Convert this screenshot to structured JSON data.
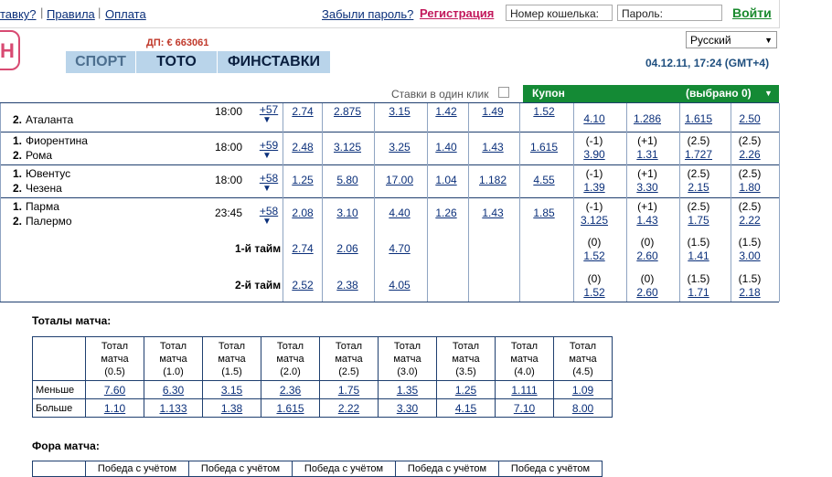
{
  "topbar": {
    "link_bet": "тавку?",
    "link_rules": "Правила",
    "link_payment": "Оплата",
    "forgot": "Забыли пароль?",
    "register": "Регистрация",
    "wallet_placeholder": "Номер кошелька:",
    "password_placeholder": "Пароль:",
    "login": "Войти"
  },
  "header": {
    "dp": "ДП: € 663061",
    "tabs": [
      "СПОРТ",
      "ТОТО",
      "ФИНСТАВКИ"
    ],
    "lang": "Русский",
    "datetime": "04.12.11, 17:24 (GMT+4)"
  },
  "coupon": {
    "one_click": "Ставки в один клик",
    "label": "Купон",
    "selected": "(выбрано 0)"
  },
  "matches": [
    {
      "team1": "",
      "team2": "Аталанта",
      "time": "18:00",
      "plus": "+57",
      "odds": [
        "2.74",
        "2.875",
        "3.15",
        "1.42",
        "1.49",
        "1.52"
      ],
      "fora1_h": "",
      "fora1_v": "4.10",
      "fora2_h": "",
      "fora2_v": "1.286",
      "tot1_h": "",
      "tot1_v": "1.615",
      "tot2_h": "",
      "tot2_v": "2.50"
    },
    {
      "team1": "Фиорентина",
      "team2": "Рома",
      "time": "18:00",
      "plus": "+59",
      "odds": [
        "2.48",
        "3.125",
        "3.25",
        "1.40",
        "1.43",
        "1.615"
      ],
      "fora1_h": "(-1)",
      "fora1_v": "3.90",
      "fora2_h": "(+1)",
      "fora2_v": "1.31",
      "tot1_h": "(2.5)",
      "tot1_v": "1.727",
      "tot2_h": "(2.5)",
      "tot2_v": "2.26"
    },
    {
      "team1": "Ювентус",
      "team2": "Чезена",
      "time": "18:00",
      "plus": "+58",
      "odds": [
        "1.25",
        "5.80",
        "17.00",
        "1.04",
        "1.182",
        "4.55"
      ],
      "fora1_h": "(-1)",
      "fora1_v": "1.39",
      "fora2_h": "(+1)",
      "fora2_v": "3.30",
      "tot1_h": "(2.5)",
      "tot1_v": "2.15",
      "tot2_h": "(2.5)",
      "tot2_v": "1.80"
    },
    {
      "team1": "Парма",
      "team2": "Палермо",
      "time": "23:45",
      "plus": "+58",
      "odds": [
        "2.08",
        "3.10",
        "4.40",
        "1.26",
        "1.43",
        "1.85"
      ],
      "fora1_h": "(-1)",
      "fora1_v": "3.125",
      "fora2_h": "(+1)",
      "fora2_v": "1.43",
      "tot1_h": "(2.5)",
      "tot1_v": "1.75",
      "tot2_h": "(2.5)",
      "tot2_v": "2.22"
    }
  ],
  "halves": [
    {
      "label": "1-й тайм",
      "odds": [
        "2.74",
        "2.06",
        "4.70"
      ],
      "fora1_h": "(0)",
      "fora1_v": "1.52",
      "fora2_h": "(0)",
      "fora2_v": "2.60",
      "tot1_h": "(1.5)",
      "tot1_v": "1.41",
      "tot2_h": "(1.5)",
      "tot2_v": "3.00"
    },
    {
      "label": "2-й тайм",
      "odds": [
        "2.52",
        "2.38",
        "4.05"
      ],
      "fora1_h": "(0)",
      "fora1_v": "1.52",
      "fora2_h": "(0)",
      "fora2_v": "2.60",
      "tot1_h": "(1.5)",
      "tot1_v": "1.71",
      "tot2_h": "(1.5)",
      "tot2_v": "2.18"
    }
  ],
  "totals": {
    "title": "Тоталы матча:",
    "header_label": "Тотал матча",
    "lines": [
      "(0.5)",
      "(1.0)",
      "(1.5)",
      "(2.0)",
      "(2.5)",
      "(3.0)",
      "(3.5)",
      "(4.0)",
      "(4.5)"
    ],
    "under_label": "Меньше",
    "under": [
      "7.60",
      "6.30",
      "3.15",
      "2.36",
      "1.75",
      "1.35",
      "1.25",
      "1.111",
      "1.09"
    ],
    "over_label": "Больше",
    "over": [
      "1.10",
      "1.133",
      "1.38",
      "1.615",
      "2.22",
      "3.30",
      "4.15",
      "7.10",
      "8.00"
    ]
  },
  "fora": {
    "title": "Фора матча:",
    "header_label": "Победа с учётом"
  },
  "colors": {
    "link": "#0a2f7a",
    "register": "#c2185b",
    "login": "#1a8a2e",
    "tab_bg": "#b9d4ea",
    "coupon_bg": "#148a35",
    "dp": "#c0392b"
  }
}
